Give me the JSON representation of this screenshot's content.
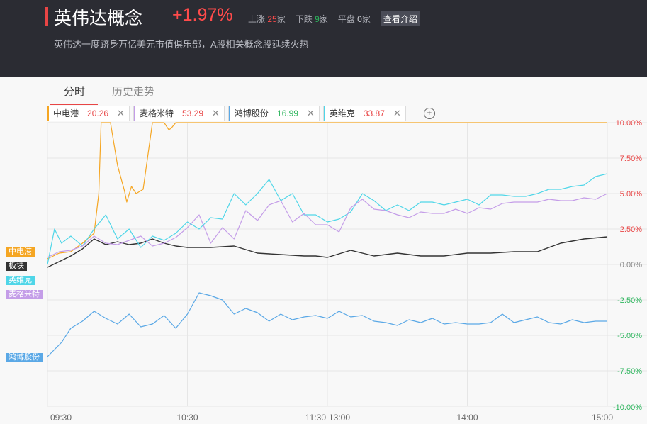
{
  "header": {
    "title": "英伟达概念",
    "change_pct": "+1.97%",
    "up_label": "上涨",
    "up_count": "25",
    "up_unit": "家",
    "down_label": "下跌",
    "down_count": "9",
    "down_unit": "家",
    "flat_label": "平盘",
    "flat_count": "0",
    "flat_unit": "家",
    "intro_button": "查看介绍",
    "subtitle": "英伟达一度跻身万亿美元市值俱乐部，A股相关概念股延续火热"
  },
  "tabs": [
    {
      "label": "分时"
    },
    {
      "label": "历史走势"
    }
  ],
  "stocks": [
    {
      "name": "中电港",
      "value": "20.26",
      "color": "#f5a623",
      "value_color": "#e84545"
    },
    {
      "name": "麦格米特",
      "value": "53.29",
      "color": "#c49de8",
      "value_color": "#e84545"
    },
    {
      "name": "鸿博股份",
      "value": "16.99",
      "color": "#5aa8e6",
      "value_color": "#2db55d"
    },
    {
      "name": "英维克",
      "value": "33.87",
      "color": "#4fd6e8",
      "value_color": "#e84545"
    }
  ],
  "close_icon": "close-icon",
  "add_icon": "plus-circle-icon",
  "chart_data": {
    "type": "line",
    "x_ticks": [
      "09:30",
      "10:30",
      "11:30",
      "13:00",
      "14:00",
      "15:00"
    ],
    "y_ticks": [
      "10.00%",
      "7.50%",
      "5.00%",
      "2.50%",
      "0.00%",
      "-2.50%",
      "-5.00%",
      "-7.50%",
      "-10.00%"
    ],
    "ylim": [
      -10,
      10
    ],
    "grid": true,
    "x_unit": "trading minutes since open (0–240)",
    "series": [
      {
        "name": "中电港",
        "color": "#f5a623",
        "x": [
          0,
          5,
          10,
          15,
          20,
          22,
          23,
          24,
          27,
          30,
          33,
          34,
          36,
          38,
          41,
          45,
          48,
          50,
          52,
          53,
          55,
          60,
          65,
          70,
          80,
          90,
          100,
          120,
          140,
          160,
          180,
          200,
          220,
          240
        ],
        "values": [
          0.4,
          0.8,
          0.9,
          1.5,
          2.2,
          5,
          10,
          10,
          10,
          7,
          5.2,
          4.4,
          5.5,
          5,
          5.3,
          10,
          10,
          10,
          9.5,
          9.6,
          10,
          10,
          10,
          10,
          10,
          10,
          10,
          10,
          10,
          10,
          10,
          10,
          10,
          10
        ]
      },
      {
        "name": "板块",
        "color": "#333333",
        "x": [
          0,
          5,
          10,
          15,
          20,
          25,
          30,
          35,
          40,
          45,
          50,
          55,
          60,
          70,
          80,
          90,
          100,
          110,
          115,
          120,
          130,
          140,
          150,
          160,
          170,
          180,
          190,
          200,
          210,
          220,
          230,
          240
        ],
        "values": [
          -0.2,
          0.2,
          0.6,
          1.1,
          1.8,
          1.4,
          1.6,
          1.4,
          1.5,
          1.8,
          1.5,
          1.3,
          1.2,
          1.2,
          1.3,
          0.8,
          0.7,
          0.6,
          0.6,
          0.5,
          1,
          0.6,
          0.8,
          0.6,
          0.6,
          0.8,
          0.8,
          0.9,
          0.9,
          1.5,
          1.8,
          1.95
        ]
      },
      {
        "name": "英维克",
        "color": "#4fd6e8",
        "x": [
          0,
          3,
          6,
          10,
          15,
          20,
          25,
          30,
          35,
          40,
          45,
          50,
          55,
          60,
          65,
          70,
          75,
          80,
          85,
          90,
          95,
          100,
          105,
          110,
          115,
          120,
          125,
          130,
          135,
          140,
          145,
          150,
          155,
          160,
          165,
          170,
          175,
          180,
          185,
          190,
          195,
          200,
          205,
          210,
          215,
          220,
          225,
          230,
          235,
          240
        ],
        "values": [
          0,
          2.5,
          1.5,
          2,
          1.3,
          2.5,
          3.5,
          1.8,
          2.5,
          1.2,
          2,
          1.7,
          2.2,
          3,
          2.5,
          3.3,
          3.2,
          5,
          4.2,
          5,
          6,
          4.5,
          5,
          3.5,
          3.5,
          3,
          3.2,
          3.7,
          5,
          4.5,
          3.8,
          4.2,
          3.8,
          4.4,
          4.4,
          4.2,
          4.4,
          4.6,
          4.2,
          4.9,
          4.9,
          4.8,
          4.8,
          5,
          5.3,
          5.3,
          5.5,
          5.6,
          6.2,
          6.4
        ]
      },
      {
        "name": "麦格米特",
        "color": "#c49de8",
        "x": [
          0,
          5,
          10,
          15,
          20,
          25,
          30,
          35,
          40,
          45,
          50,
          55,
          60,
          65,
          70,
          75,
          80,
          85,
          90,
          95,
          100,
          105,
          110,
          115,
          120,
          125,
          130,
          135,
          140,
          145,
          150,
          155,
          160,
          165,
          170,
          175,
          180,
          185,
          190,
          195,
          200,
          205,
          210,
          215,
          220,
          225,
          230,
          235,
          240
        ],
        "values": [
          0.5,
          0.9,
          1,
          1.3,
          2,
          1.5,
          1.4,
          1.7,
          2,
          1.3,
          1.5,
          1.9,
          2.6,
          3.5,
          1.5,
          2.6,
          1.8,
          3.8,
          3.1,
          4.2,
          4.5,
          3,
          3.6,
          2.8,
          2.8,
          2.3,
          4,
          4.6,
          3.9,
          3.8,
          3.5,
          3.3,
          3.7,
          3.6,
          3.6,
          3.9,
          3.6,
          4,
          3.9,
          4.3,
          4.4,
          4.4,
          4.4,
          4.6,
          4.5,
          4.5,
          4.7,
          4.6,
          5
        ]
      },
      {
        "name": "鸿博股份",
        "color": "#5aa8e6",
        "x": [
          0,
          3,
          6,
          10,
          15,
          20,
          25,
          30,
          35,
          40,
          45,
          50,
          55,
          60,
          65,
          70,
          75,
          80,
          85,
          90,
          95,
          100,
          105,
          110,
          115,
          120,
          125,
          130,
          135,
          140,
          145,
          150,
          155,
          160,
          165,
          170,
          175,
          180,
          185,
          190,
          195,
          200,
          205,
          210,
          215,
          220,
          225,
          230,
          235,
          240
        ],
        "values": [
          -6.5,
          -6,
          -5.5,
          -4.5,
          -4,
          -3.3,
          -3.8,
          -4.2,
          -3.5,
          -4.4,
          -4.2,
          -3.6,
          -4.5,
          -3.5,
          -2,
          -2.2,
          -2.5,
          -3.5,
          -3.1,
          -3.4,
          -4,
          -3.5,
          -3.9,
          -3.7,
          -3.6,
          -3.8,
          -3.3,
          -3.7,
          -3.6,
          -4,
          -4.1,
          -4.3,
          -3.9,
          -4.1,
          -3.8,
          -4.2,
          -4.1,
          -4.2,
          -4.2,
          -4.1,
          -3.5,
          -4.1,
          -3.9,
          -3.7,
          -4.1,
          -4.2,
          -3.9,
          -4.1,
          -4,
          -4
        ]
      }
    ]
  }
}
